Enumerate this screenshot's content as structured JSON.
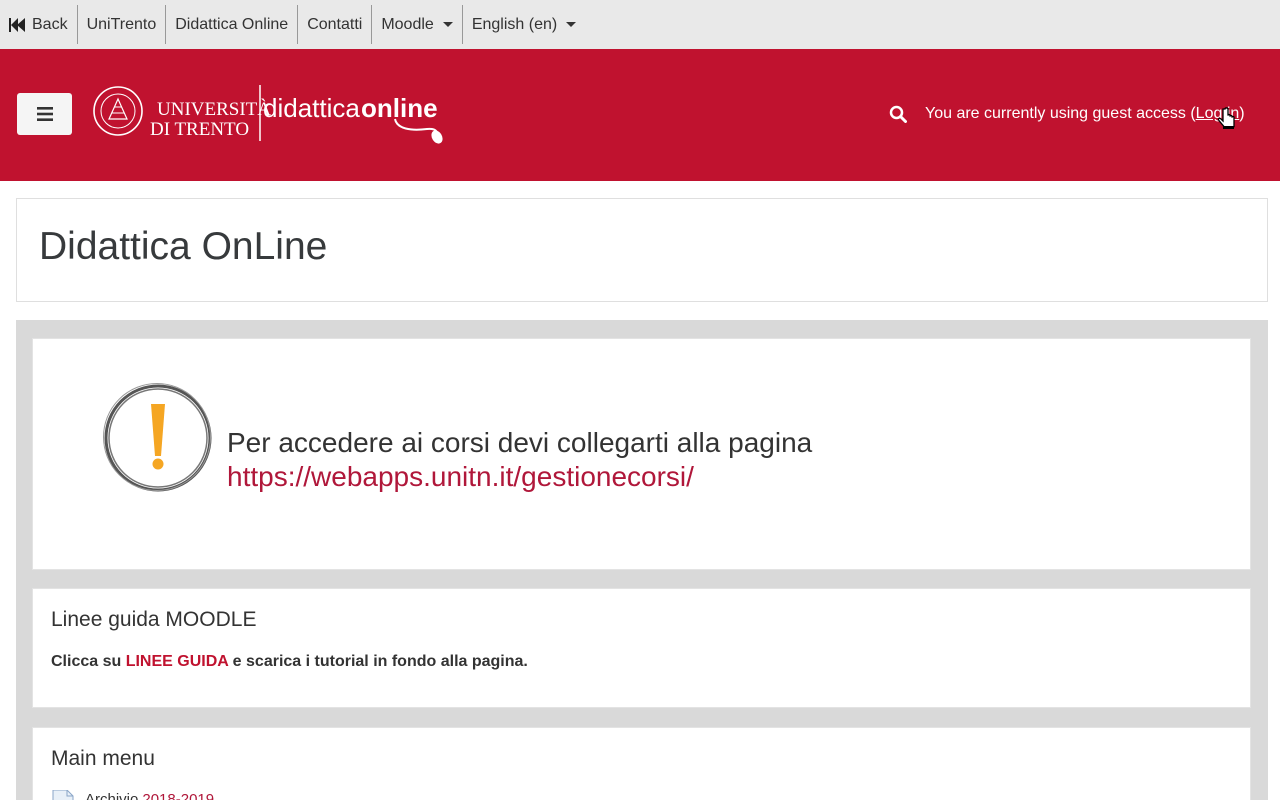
{
  "topnav": {
    "items": [
      {
        "label": "Back"
      },
      {
        "label": "UniTrento"
      },
      {
        "label": "Didattica Online"
      },
      {
        "label": "Contatti"
      },
      {
        "label": "Moodle"
      },
      {
        "label": "English (en)"
      }
    ]
  },
  "header": {
    "logo_text_1": "UNIVERSITÀ",
    "logo_text_2": "DI TRENTO",
    "logo_text_3": "didattica",
    "logo_text_4": "online",
    "guest_prefix": "You are currently using guest access (",
    "login_label": "Log in",
    "guest_suffix": ")"
  },
  "page": {
    "title": "Didattica OnLine"
  },
  "notice": {
    "line1": "Per accedere ai corsi devi collegarti alla pagina",
    "link": "https://webapps.unitn.it/gestionecorsi/"
  },
  "linee": {
    "title": "Linee guida MOODLE",
    "pre": "Clicca su ",
    "link": "LINEE GUIDA",
    "post": " e scarica i tutorial in fondo alla pagina."
  },
  "mainmenu": {
    "title": "Main menu",
    "item_prefix": "Archivio",
    "item_link": "2018-2019"
  },
  "colors": {
    "brand_red": "#c0122f",
    "link_red": "#b0173a",
    "notice_orange": "#f5a623"
  }
}
